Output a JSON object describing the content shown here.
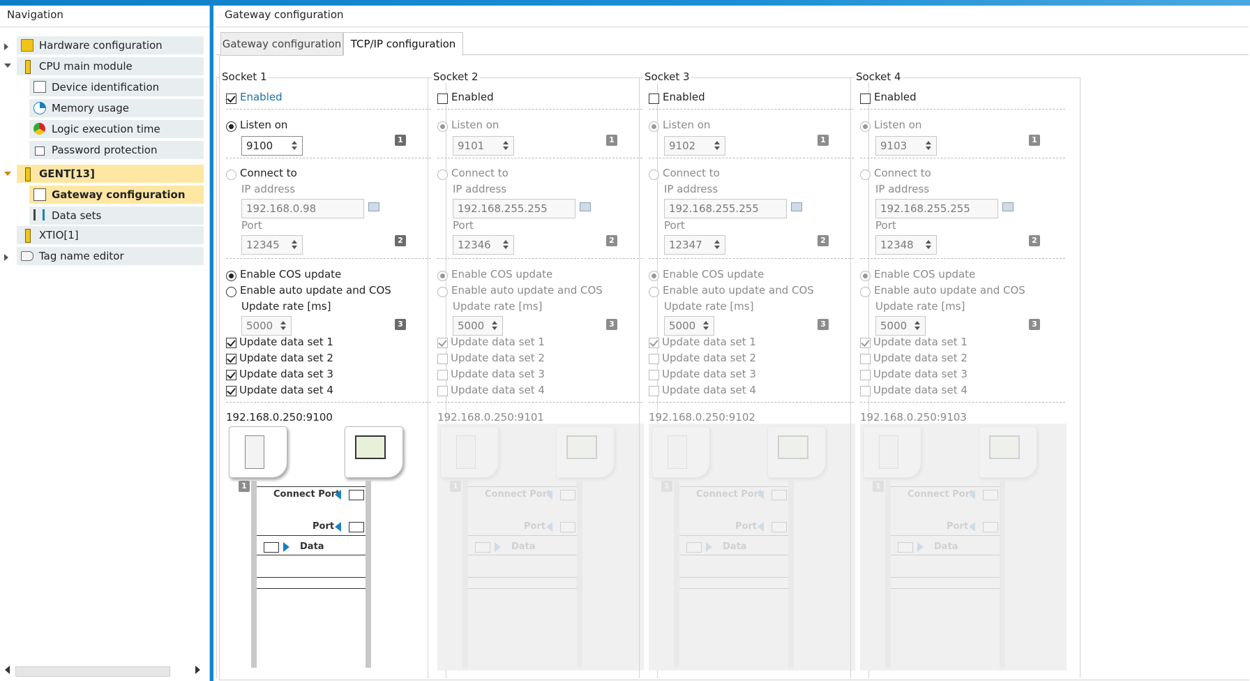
{
  "navigation": {
    "title": "Navigation",
    "items": [
      {
        "label": "Hardware configuration",
        "icon": "hardware-icon",
        "expand": "collapsed"
      },
      {
        "label": "CPU main module",
        "icon": "cpu-module-icon",
        "expand": "expanded"
      },
      {
        "label": "Device identification",
        "icon": "device-id-icon"
      },
      {
        "label": "Memory usage",
        "icon": "memory-pie-icon"
      },
      {
        "label": "Logic execution time",
        "icon": "gauge-icon"
      },
      {
        "label": "Password protection",
        "icon": "lock-icon"
      },
      {
        "label": "GENT[13]",
        "icon": "gateway-module-icon",
        "expand": "expanded",
        "selected_parent": true
      },
      {
        "label": "Gateway configuration",
        "icon": "gateway-config-icon",
        "selected": true
      },
      {
        "label": "Data sets",
        "icon": "data-sets-icon"
      },
      {
        "label": "XTIO[1]",
        "icon": "io-module-icon"
      },
      {
        "label": "Tag name editor",
        "icon": "tag-icon",
        "expand": "collapsed"
      }
    ]
  },
  "main": {
    "title": "Gateway configuration",
    "tabs": [
      {
        "label": "Gateway configuration",
        "active": false
      },
      {
        "label": "TCP/IP configuration",
        "active": true
      }
    ]
  },
  "labels": {
    "enabled": "Enabled",
    "listen_on": "Listen on",
    "connect_to": "Connect to",
    "ip_address": "IP address",
    "port": "Port",
    "enable_cos": "Enable COS update",
    "enable_auto": "Enable auto update and COS",
    "update_rate": "Update rate [ms]",
    "update_ds1": "Update data set 1",
    "update_ds2": "Update data set 2",
    "update_ds3": "Update data set 3",
    "update_ds4": "Update data set 4",
    "diagram_connect_port": "Connect Port",
    "diagram_port": "Port",
    "diagram_data": "Data"
  },
  "sockets": [
    {
      "name": "Socket 1",
      "enabled": true,
      "listen_port": "9100",
      "ip_address": "192.168.0.98",
      "connect_port": "12345",
      "update_rate": "5000",
      "data_sets": [
        true,
        true,
        true,
        true
      ],
      "endpoint": "192.168.0.250:9100",
      "badge1": "1",
      "badge2": "2",
      "badge3": "3",
      "diagram_badge": "1"
    },
    {
      "name": "Socket 2",
      "enabled": false,
      "listen_port": "9101",
      "ip_address": "192.168.255.255",
      "connect_port": "12346",
      "update_rate": "5000",
      "data_sets": [
        true,
        false,
        false,
        false
      ],
      "endpoint": "192.168.0.250:9101",
      "badge1": "1",
      "badge2": "2",
      "badge3": "3",
      "diagram_badge": "1"
    },
    {
      "name": "Socket 3",
      "enabled": false,
      "listen_port": "9102",
      "ip_address": "192.168.255.255",
      "connect_port": "12347",
      "update_rate": "5000",
      "data_sets": [
        true,
        false,
        false,
        false
      ],
      "endpoint": "192.168.0.250:9102",
      "badge1": "1",
      "badge2": "2",
      "badge3": "3",
      "diagram_badge": "1"
    },
    {
      "name": "Socket 4",
      "enabled": false,
      "listen_port": "9103",
      "ip_address": "192.168.255.255",
      "connect_port": "12348",
      "update_rate": "5000",
      "data_sets": [
        true,
        false,
        false,
        false
      ],
      "endpoint": "192.168.0.250:9103",
      "badge1": "1",
      "badge2": "2",
      "badge3": "3",
      "diagram_badge": "1"
    }
  ],
  "colors": {
    "accent": "#1586cf",
    "selection": "#fde7a3",
    "tree_bg": "#e8eef0",
    "enabled_label": "#1a6fb0"
  }
}
